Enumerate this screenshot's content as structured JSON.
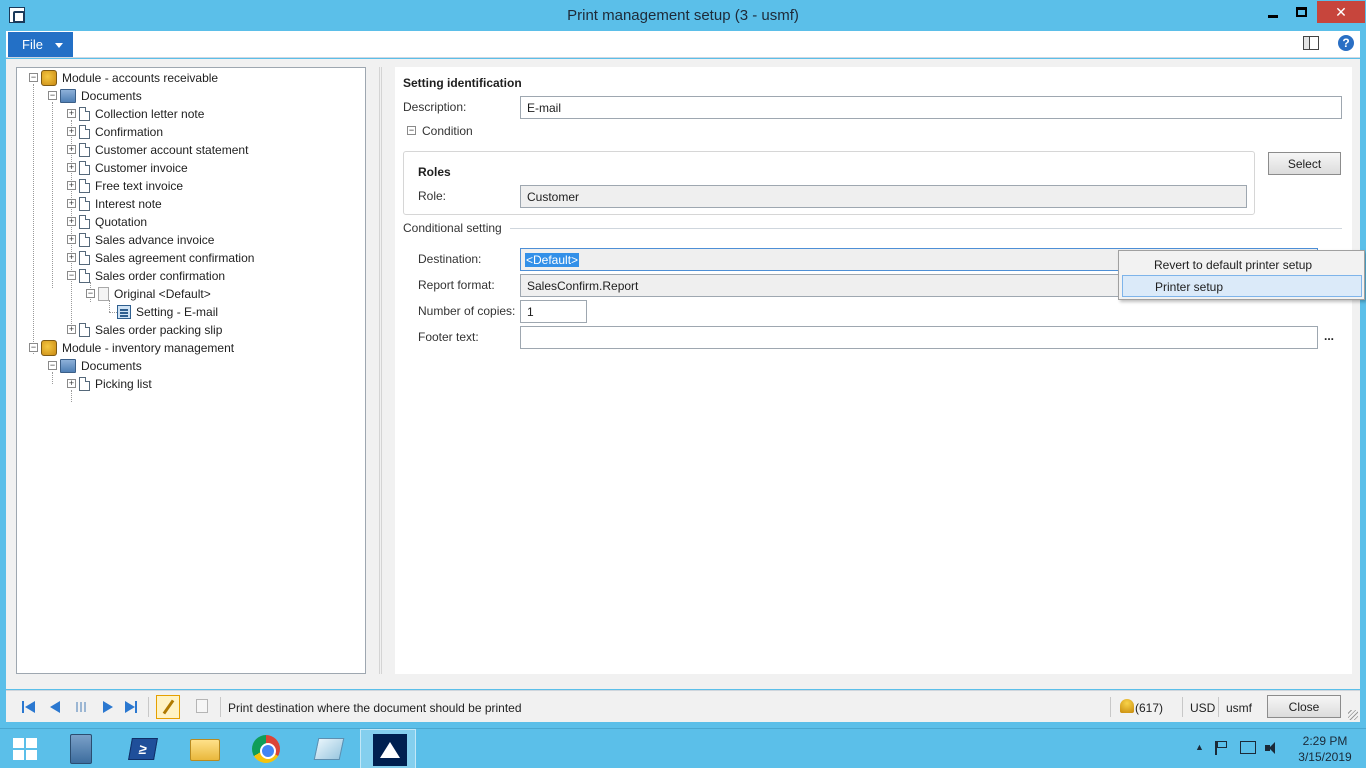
{
  "window": {
    "title": "Print management setup (3 - usmf)",
    "close_glyph": "✕"
  },
  "menu": {
    "file_label": "File",
    "help_glyph": "?"
  },
  "tree": {
    "module_ar": "Module - accounts receivable",
    "documents_ar": "Documents",
    "items_ar": [
      "Collection letter note",
      "Confirmation",
      "Customer account statement",
      "Customer invoice",
      "Free text invoice",
      "Interest note",
      "Quotation",
      "Sales advance invoice",
      "Sales agreement confirmation",
      "Sales order confirmation"
    ],
    "original": "Original <Default>",
    "setting": "Setting - E-mail",
    "packing_slip": "Sales order packing slip",
    "module_inv": "Module - inventory management",
    "documents_inv": "Documents",
    "picking_list": "Picking list"
  },
  "form": {
    "setting_identification": "Setting identification",
    "description_label": "Description:",
    "description_value": "E-mail",
    "condition_label": "Condition",
    "roles_title": "Roles",
    "role_label": "Role:",
    "role_value": "Customer",
    "select_button": "Select",
    "conditional_setting": "Conditional setting",
    "destination_label": "Destination:",
    "destination_value": "<Default>",
    "report_format_label": "Report format:",
    "report_format_value": "SalesConfirm.Report",
    "copies_label": "Number of copies:",
    "copies_value": "1",
    "footer_label": "Footer text:",
    "footer_value": "",
    "ellipsis": "..."
  },
  "context_menu": {
    "items": [
      "Revert to default printer setup",
      "Printer setup"
    ]
  },
  "statusbar": {
    "help_text": "Print destination where the document should be printed",
    "notifications": "(617)",
    "currency": "USD",
    "company": "usmf",
    "close_button": "Close"
  },
  "taskbar": {
    "ps_glyph": "≥",
    "tray_chevron": "▲",
    "time": "2:29 PM",
    "date": "3/15/2019"
  }
}
